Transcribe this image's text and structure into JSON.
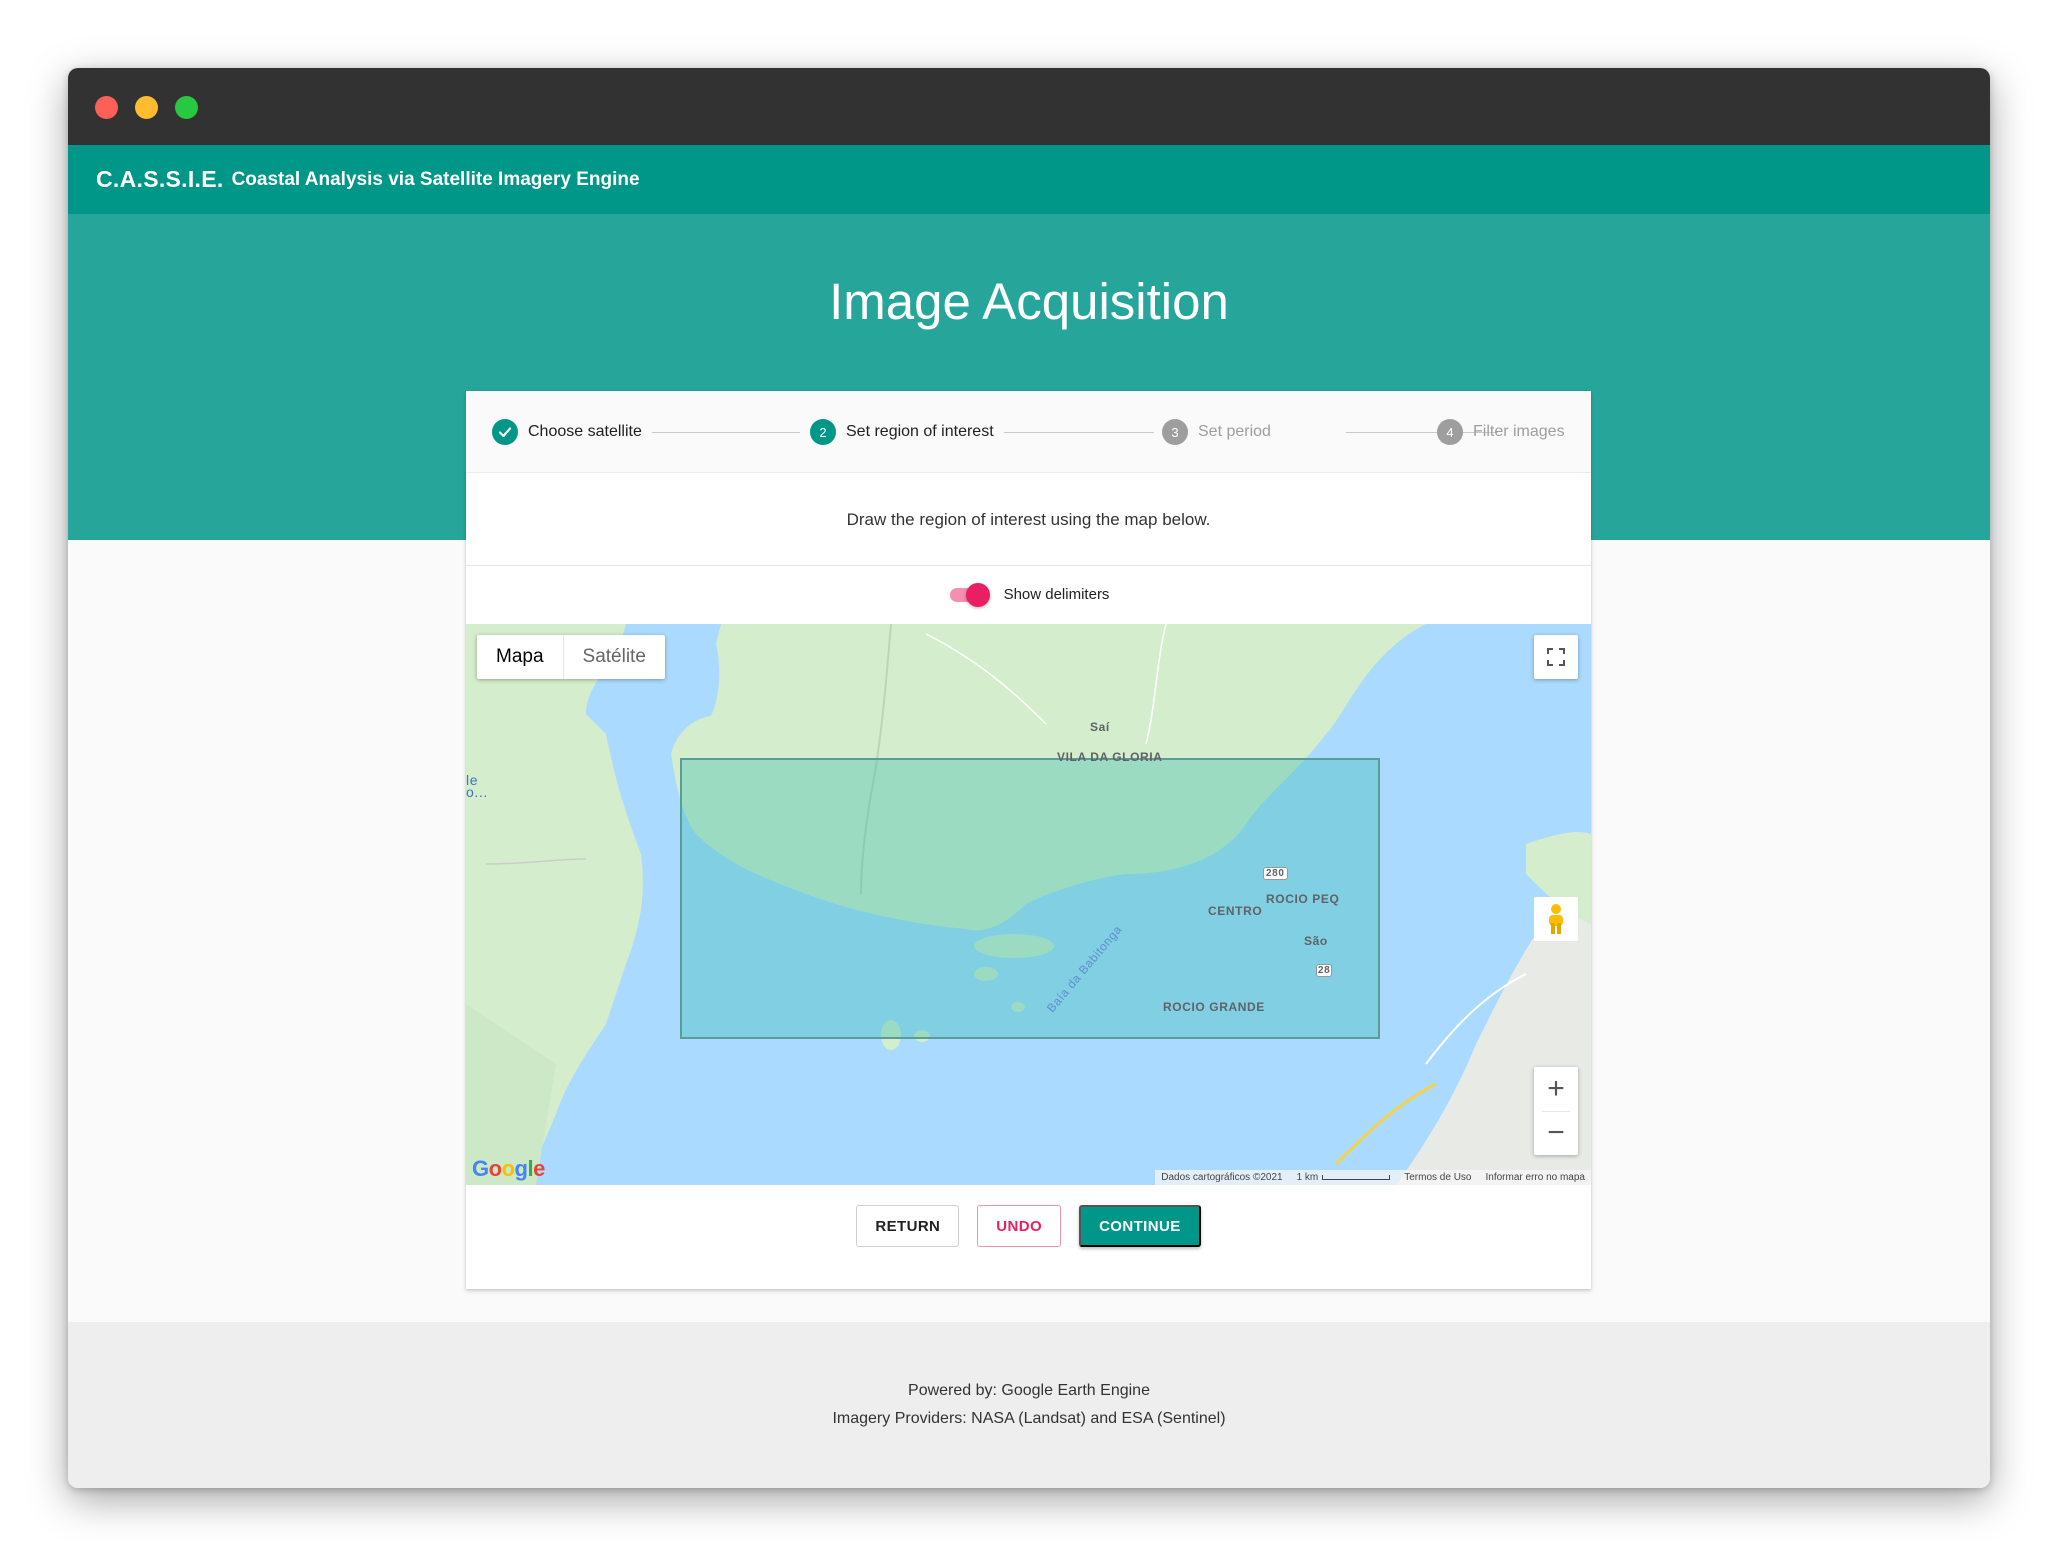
{
  "app": {
    "brand": "C.A.S.S.I.E.",
    "subtitle": "Coastal Analysis via Satellite Imagery Engine"
  },
  "page_title": "Image Acquisition",
  "stepper": {
    "steps": [
      {
        "number": "1",
        "label": "Choose satellite",
        "state": "done"
      },
      {
        "number": "2",
        "label": "Set region of interest",
        "state": "active"
      },
      {
        "number": "3",
        "label": "Set period",
        "state": "pending"
      },
      {
        "number": "4",
        "label": "Filter images",
        "state": "pending"
      }
    ]
  },
  "instruction": "Draw the region of interest using the map below.",
  "toggle": {
    "label": "Show delimiters",
    "checked": true,
    "color": "#e91e63"
  },
  "map": {
    "type_options": [
      "Mapa",
      "Satélite"
    ],
    "selected_type": "Mapa",
    "labels": {
      "sai": "Saí",
      "vila_da_gloria": "VILA DA GLORIA",
      "centro": "CENTRO",
      "rocio_peq": "ROCIO PEQ",
      "sao": "São",
      "rocio_grande": "ROCIO GRANDE",
      "baia": "Baía da Babitonga",
      "road_280": "280",
      "road_28": "28",
      "left_le": "le",
      "left_o": "o..."
    },
    "google_logo": "Google",
    "attribution": {
      "data": "Dados cartográficos ©2021",
      "scale": "1 km",
      "terms": "Termos de Uso",
      "report": "Informar erro no mapa"
    },
    "zoom_in": "+",
    "zoom_out": "−"
  },
  "actions": {
    "return": "RETURN",
    "undo": "UNDO",
    "continue": "CONTINUE"
  },
  "footer": {
    "line1": "Powered by: Google Earth Engine",
    "line2": "Imagery Providers: NASA (Landsat) and ESA (Sentinel)"
  },
  "colors": {
    "primary": "#009688",
    "hero": "#26a69a",
    "accent": "#e91e63",
    "water": "#aadaff",
    "land": "#d4edcc"
  }
}
